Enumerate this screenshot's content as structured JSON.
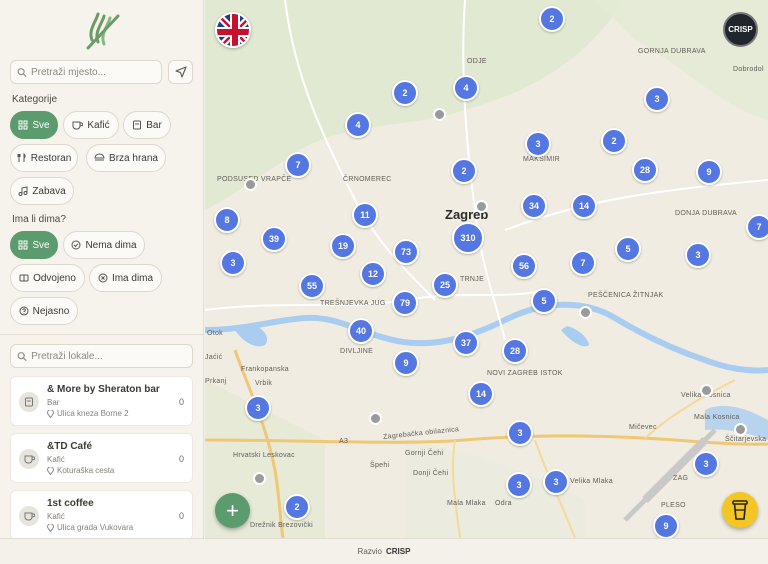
{
  "sidebar": {
    "search_placeholder": "Pretraži mjesto...",
    "categories_title": "Kategorije",
    "categories": [
      {
        "label": "Sve",
        "icon": "grid-icon",
        "active": true
      },
      {
        "label": "Kafić",
        "icon": "coffee-icon",
        "active": false
      },
      {
        "label": "Bar",
        "icon": "bar-icon",
        "active": false
      },
      {
        "label": "Restoran",
        "icon": "restaurant-icon",
        "active": false
      },
      {
        "label": "Brza hrana",
        "icon": "fastfood-icon",
        "active": false
      },
      {
        "label": "Zabava",
        "icon": "music-icon",
        "active": false
      }
    ],
    "smoke_title": "Ima li dima?",
    "smoke_filters": [
      {
        "label": "Sve",
        "icon": "grid-icon",
        "active": true
      },
      {
        "label": "Nema dima",
        "icon": "check-circle-icon",
        "active": false
      },
      {
        "label": "Odvojeno",
        "icon": "split-icon",
        "active": false
      },
      {
        "label": "Ima dima",
        "icon": "x-circle-icon",
        "active": false
      },
      {
        "label": "Nejasno",
        "icon": "question-icon",
        "active": false
      }
    ],
    "places_search_placeholder": "Pretraži lokale...",
    "places": [
      {
        "name": "& More by Sheraton bar",
        "category": "Bar",
        "address": "Ulica kneza Borne 2",
        "count": "0",
        "icon": "bar-icon"
      },
      {
        "name": "&TD Café",
        "category": "Kafić",
        "address": "Koturaška cesta",
        "count": "0",
        "icon": "coffee-icon"
      },
      {
        "name": "1st coffee",
        "category": "Kafić",
        "address": "Ulica grada Vukovara",
        "count": "0",
        "icon": "coffee-icon"
      }
    ]
  },
  "map": {
    "brand_badge": "CRISP",
    "language_flag": "uk-flag-icon",
    "city_label": "Zagreb",
    "labels": [
      "GORNJA DUBRAVA",
      "Dobrodol",
      "PODSUSED VRAPČE",
      "ČRNOMEREC",
      "MAKSIMIR",
      "DONJA DUBRAVA",
      "TRNJE",
      "TREŠNJEVKA JUG",
      "PEŠČENICA ŽITNJAK",
      "NOVI ZAGREB ISTOK",
      "Velika Mlaka",
      "Mala Mlaka",
      "Odra",
      "Hrvatski Leskovac",
      "Gornji Čehi",
      "Donji Čehi",
      "Mičevec",
      "Mala Kosnica",
      "Ščitarjevska",
      "Velika Kosnica",
      "PLESO",
      "ZAG",
      "Drežnik Brezovički",
      "A3",
      "Zagrebačka obilaznica",
      "ODJE",
      "Frankopanska",
      "Vrbik",
      "Špehi",
      "DIVLJINE",
      "Jaćić",
      "Prkanj",
      "Otok"
    ],
    "clusters": [
      "2",
      "2",
      "4",
      "3",
      "4",
      "3",
      "2",
      "7",
      "2",
      "28",
      "9",
      "8",
      "11",
      "310",
      "34",
      "14",
      "39",
      "19",
      "73",
      "5",
      "3",
      "7",
      "3",
      "12",
      "56",
      "55",
      "25",
      "79",
      "5",
      "7",
      "40",
      "37",
      "28",
      "9",
      "14",
      "3",
      "3",
      "3",
      "3",
      "3",
      "2",
      "9"
    ]
  },
  "footer": {
    "prefix": "Razvio",
    "brand": "CRISP"
  },
  "colors": {
    "accent": "#5b9b6e",
    "cluster": "#5477e2",
    "water": "#a9cdf0",
    "cup": "#f3c623"
  }
}
